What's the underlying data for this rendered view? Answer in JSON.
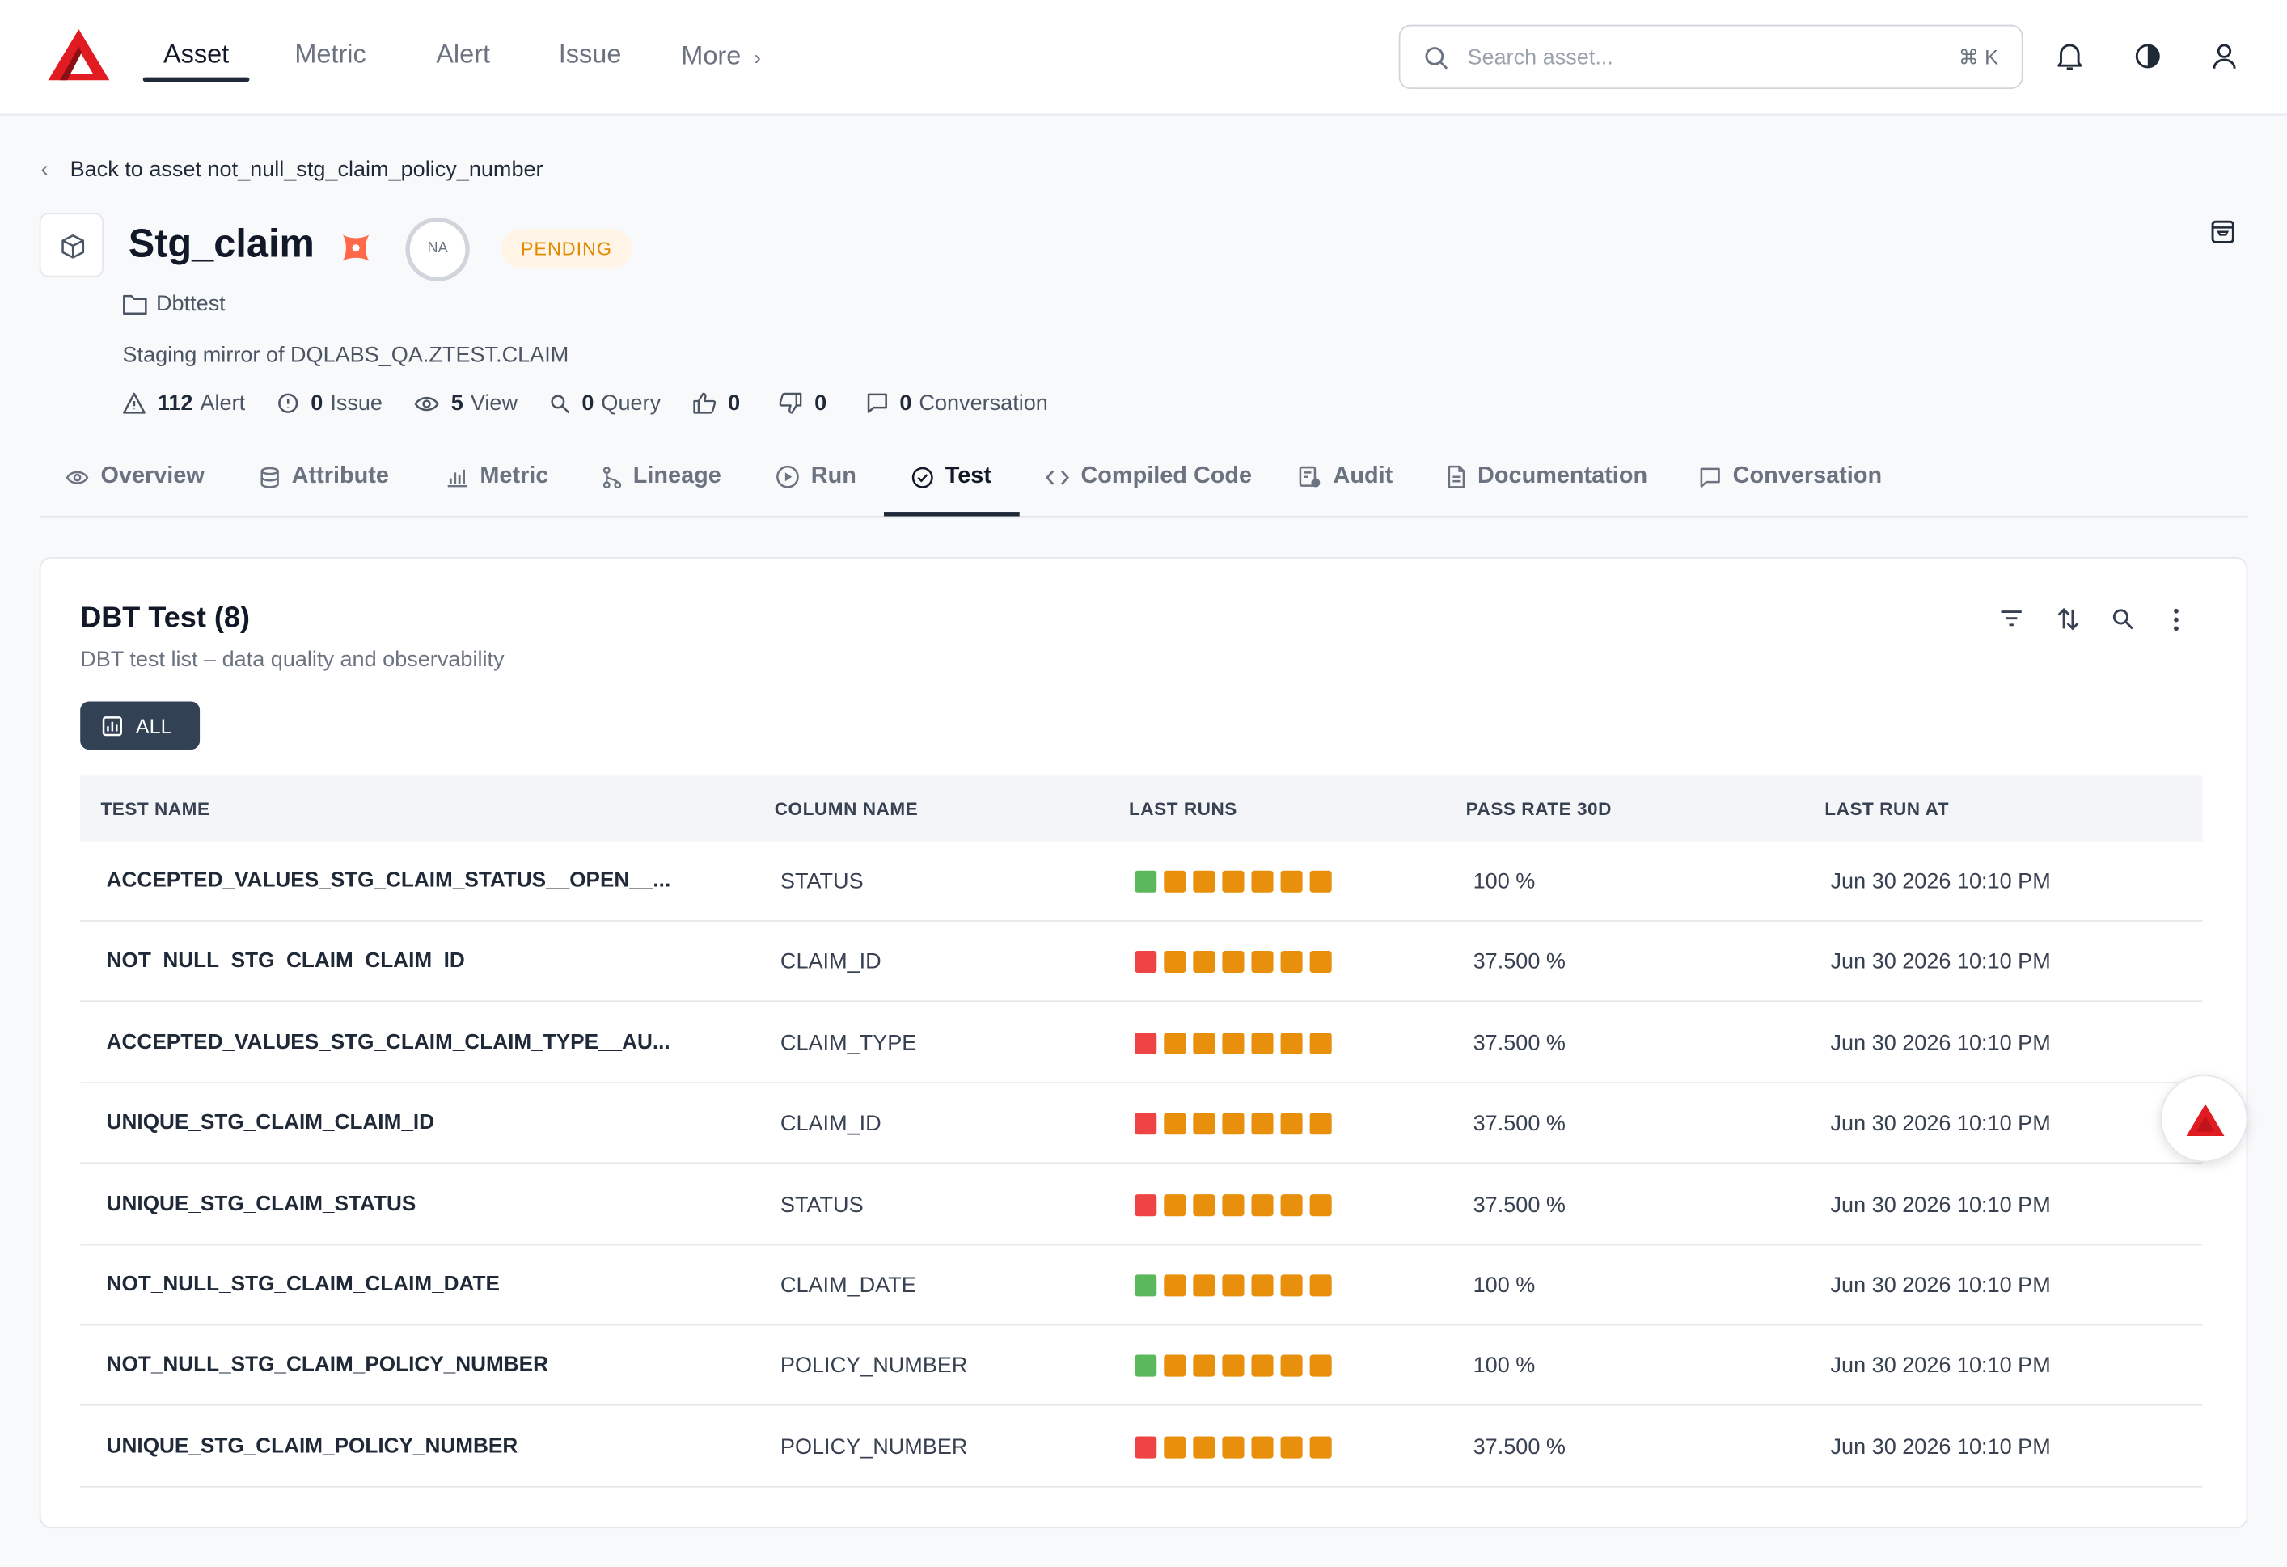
{
  "colors": {
    "brand_red": "#e01b22",
    "pass": "#5cb85c",
    "fail": "#ef4444",
    "warn": "#e8900c",
    "pending_text": "#e08a00",
    "pending_bg": "#fff4e5",
    "dark_btn": "#334155"
  },
  "nav": {
    "items": [
      "Asset",
      "Metric",
      "Alert",
      "Issue"
    ],
    "more": "More",
    "search_placeholder": "Search asset...",
    "search_shortcut": "⌘ K"
  },
  "header": {
    "back_text": "Back to asset not_null_stg_claim_policy_number",
    "title": "Stg_claim",
    "score": "NA",
    "status": "PENDING",
    "folder": "Dbttest",
    "description": "Staging mirror of DQLABS_QA.ZTEST.CLAIM",
    "stats": [
      {
        "icon": "alert-triangle-icon",
        "count": "112",
        "label": "Alert"
      },
      {
        "icon": "issue-icon",
        "count": "0",
        "label": "Issue"
      },
      {
        "icon": "eye-icon",
        "count": "5",
        "label": "View"
      },
      {
        "icon": "query-icon",
        "count": "0",
        "label": "Query"
      },
      {
        "icon": "thumbs-up-icon",
        "count": "0",
        "label": ""
      },
      {
        "icon": "thumbs-down-icon",
        "count": "0",
        "label": ""
      },
      {
        "icon": "chat-icon",
        "count": "0",
        "label": "Conversation"
      }
    ]
  },
  "tabs": [
    "Overview",
    "Attribute",
    "Metric",
    "Lineage",
    "Run",
    "Test",
    "Compiled Code",
    "Audit",
    "Documentation",
    "Conversation"
  ],
  "card": {
    "title": "DBT Test (8)",
    "subtitle": "DBT test list – data quality and observability",
    "filter_label": "ALL",
    "columns": [
      "TEST NAME",
      "COLUMN NAME",
      "LAST RUNS",
      "PASS RATE 30D",
      "LAST RUN AT"
    ],
    "rows": [
      {
        "name": "ACCEPTED_VALUES_STG_CLAIM_STATUS__OPEN__...",
        "column": "STATUS",
        "runs": [
          "pass",
          "warn",
          "warn",
          "warn",
          "warn",
          "warn",
          "warn"
        ],
        "rate": "100 %",
        "at": "Jun 30 2026 10:10 PM"
      },
      {
        "name": "NOT_NULL_STG_CLAIM_CLAIM_ID",
        "column": "CLAIM_ID",
        "runs": [
          "fail",
          "warn",
          "warn",
          "warn",
          "warn",
          "warn",
          "warn"
        ],
        "rate": "37.500 %",
        "at": "Jun 30 2026 10:10 PM"
      },
      {
        "name": "ACCEPTED_VALUES_STG_CLAIM_CLAIM_TYPE__AU...",
        "column": "CLAIM_TYPE",
        "runs": [
          "fail",
          "warn",
          "warn",
          "warn",
          "warn",
          "warn",
          "warn"
        ],
        "rate": "37.500 %",
        "at": "Jun 30 2026 10:10 PM"
      },
      {
        "name": "UNIQUE_STG_CLAIM_CLAIM_ID",
        "column": "CLAIM_ID",
        "runs": [
          "fail",
          "warn",
          "warn",
          "warn",
          "warn",
          "warn",
          "warn"
        ],
        "rate": "37.500 %",
        "at": "Jun 30 2026 10:10 PM"
      },
      {
        "name": "UNIQUE_STG_CLAIM_STATUS",
        "column": "STATUS",
        "runs": [
          "fail",
          "warn",
          "warn",
          "warn",
          "warn",
          "warn",
          "warn"
        ],
        "rate": "37.500 %",
        "at": "Jun 30 2026 10:10 PM"
      },
      {
        "name": "NOT_NULL_STG_CLAIM_CLAIM_DATE",
        "column": "CLAIM_DATE",
        "runs": [
          "pass",
          "warn",
          "warn",
          "warn",
          "warn",
          "warn",
          "warn"
        ],
        "rate": "100 %",
        "at": "Jun 30 2026 10:10 PM"
      },
      {
        "name": "NOT_NULL_STG_CLAIM_POLICY_NUMBER",
        "column": "POLICY_NUMBER",
        "runs": [
          "pass",
          "warn",
          "warn",
          "warn",
          "warn",
          "warn",
          "warn"
        ],
        "rate": "100 %",
        "at": "Jun 30 2026 10:10 PM"
      },
      {
        "name": "UNIQUE_STG_CLAIM_POLICY_NUMBER",
        "column": "POLICY_NUMBER",
        "runs": [
          "fail",
          "warn",
          "warn",
          "warn",
          "warn",
          "warn",
          "warn"
        ],
        "rate": "37.500 %",
        "at": "Jun 30 2026 10:10 PM"
      }
    ]
  }
}
